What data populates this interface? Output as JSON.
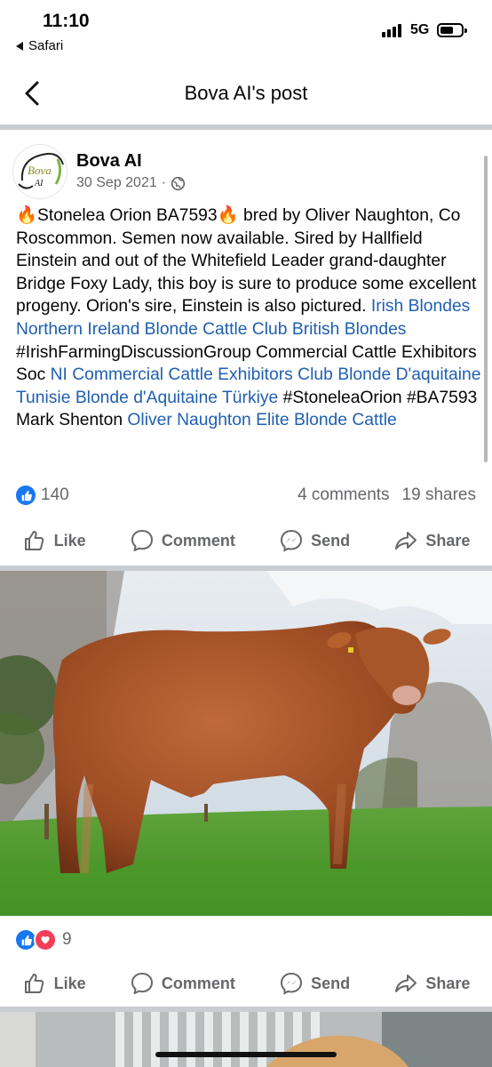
{
  "status_bar": {
    "time": "11:10",
    "back_app": "Safari",
    "network": "5G"
  },
  "header": {
    "title": "Bova AI's post"
  },
  "post": {
    "author": "Bova AI",
    "avatar_text_1": "Bova",
    "avatar_text_2": "AI",
    "date": "30 Sep 2021",
    "separator": "·",
    "text": {
      "p1": "Stonelea Orion BA7593",
      "p2": " bred by Oliver Naughton, Co Roscommon. Semen now available. Sired by Hallfield Einstein and out of the Whitefield Leader grand-daughter Bridge Foxy Lady, this boy is sure to produce some excellent progeny. Orion's sire, Einstein is also pictured. ",
      "link1": "Irish Blondes",
      "link2": "Northern Ireland Blonde Cattle Club",
      "link3": "British Blondes",
      "p3": " #IrishFarmingDiscussionGroup Commercial Cattle Exhibitors Soc ",
      "link4": "NI Commercial Cattle Exhibitors Club",
      "link5": "Blonde D'aquitaine Tunisie",
      "link6": "Blonde d'Aquitaine Türkiye",
      "p4": " #StoneleaOrion #BA7593 Mark Shenton ",
      "link7": "Oliver Naughton",
      "link8": "Elite Blonde Cattle"
    },
    "reaction_count": "140",
    "comments": "4 comments",
    "shares": "19 shares"
  },
  "actions": {
    "like": "Like",
    "comment": "Comment",
    "send": "Send",
    "share": "Share"
  },
  "photo1": {
    "reaction_count": "9"
  },
  "colors": {
    "accent": "#1877f2",
    "link": "#1f5fb0",
    "secondary_text": "#65676b",
    "separator": "#c9ccd1"
  }
}
